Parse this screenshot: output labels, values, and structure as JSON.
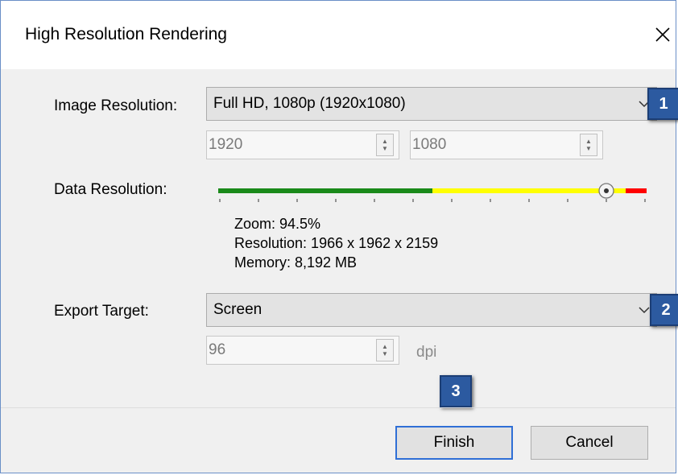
{
  "dialog": {
    "title": "High Resolution Rendering",
    "close_icon": "close-icon"
  },
  "image_resolution": {
    "label": "Image Resolution:",
    "selected": "Full HD, 1080p (1920x1080)",
    "width": "1920",
    "height": "1080"
  },
  "data_resolution": {
    "label": "Data Resolution:",
    "slider_fraction": 0.85,
    "colors": {
      "green": "#1a8a1a",
      "yellow": "#ffff00",
      "red": "#ff0000"
    },
    "zoom_text": "Zoom: 94.5%",
    "resolution_text": "Resolution: 1966 x 1962 x 2159",
    "memory_text": "Memory: 8,192 MB"
  },
  "export_target": {
    "label": "Export Target:",
    "selected": "Screen",
    "dpi_value": "96",
    "dpi_unit": "dpi"
  },
  "badges": [
    "1",
    "2",
    "3"
  ],
  "buttons": {
    "finish": "Finish",
    "cancel": "Cancel"
  }
}
